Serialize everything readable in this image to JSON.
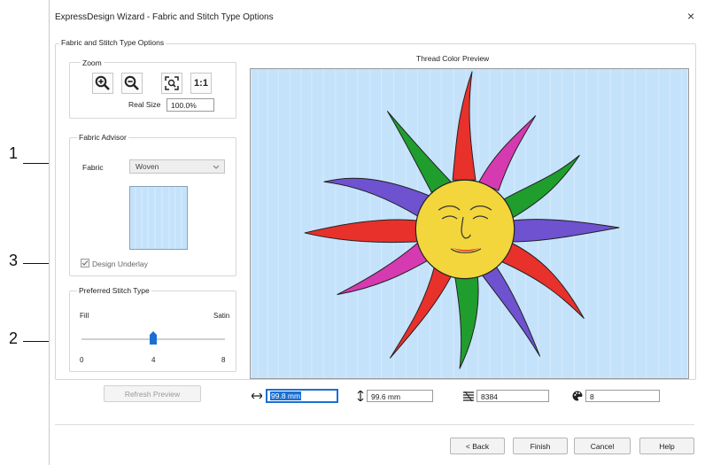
{
  "window": {
    "title": "ExpressDesign Wizard - Fabric and Stitch Type Options",
    "close_glyph": "×"
  },
  "group_title": "Fabric and Stitch Type Options",
  "zoom": {
    "label": "Zoom",
    "real_size_label": "Real Size",
    "real_size_value": "100.0%",
    "one_to_one": "1:1"
  },
  "fabric_advisor": {
    "label": "Fabric Advisor",
    "fabric_label": "Fabric",
    "fabric_value": "Woven",
    "design_underlay_label": "Design Underlay",
    "design_underlay_checked": true
  },
  "stitch_type": {
    "label": "Preferred Stitch Type",
    "left_label": "Fill",
    "right_label": "Satin",
    "min": "0",
    "mid": "4",
    "max": "8",
    "value": 4,
    "range_max": 8
  },
  "refresh_button": "Refresh Preview",
  "preview": {
    "title": "Thread Color Preview"
  },
  "metrics": {
    "width": "99.8 mm",
    "height": "99.6 mm",
    "stitches": "8384",
    "colors": "8"
  },
  "footer": {
    "back": "< Back",
    "finish": "Finish",
    "cancel": "Cancel",
    "help": "Help"
  },
  "callouts": {
    "c1": "1",
    "c2": "2",
    "c3": "3"
  },
  "colors": {
    "fabric_blue": "#c5e2fb",
    "sun_yellow": "#f2d63c",
    "ray_colors": [
      "#e8312b",
      "#d63ab0",
      "#1f9e2e",
      "#6e52cf"
    ]
  }
}
